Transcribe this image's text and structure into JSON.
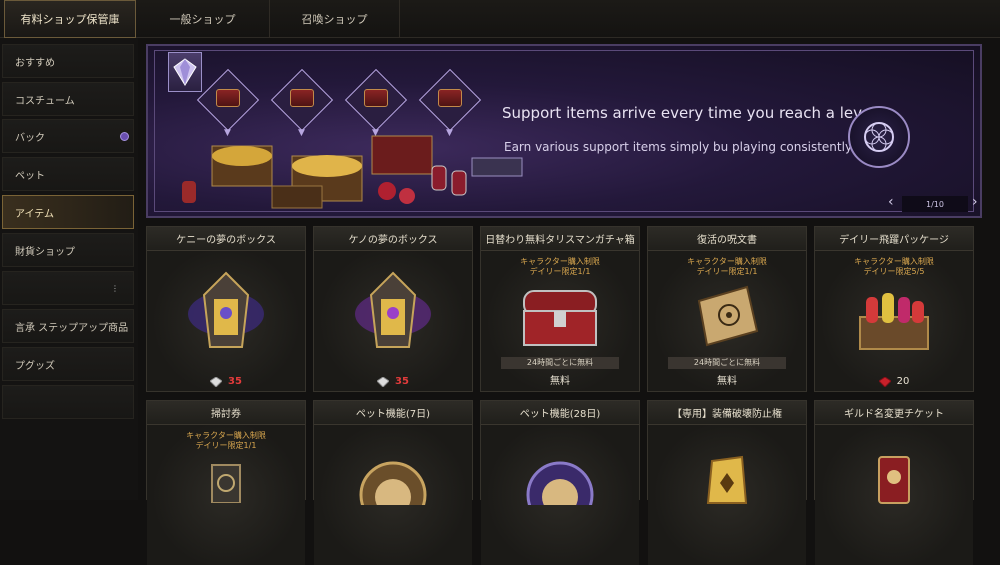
{
  "top_tabs": [
    {
      "label": "有料ショップ保管庫",
      "active": true
    },
    {
      "label": "一般ショップ",
      "active": false
    },
    {
      "label": "召喚ショップ",
      "active": false
    }
  ],
  "sidebar": {
    "items": [
      {
        "label": "おすすめ"
      },
      {
        "label": "コスチューム"
      },
      {
        "label": "バック"
      },
      {
        "label": "ペット"
      },
      {
        "label": "アイテム"
      },
      {
        "label": "財貨ショップ"
      },
      {
        "label": ""
      },
      {
        "label": "言承 ステップアップ商品"
      },
      {
        "label": "プグッズ"
      },
      {
        "label": ""
      }
    ]
  },
  "banner": {
    "title": "Support items arrive every time you reach a level!",
    "subtitle": "Earn various support items simply bu playing consistently.",
    "page": "1/10",
    "accent": "#6b4fa8"
  },
  "products_row1": [
    {
      "title": "ケニーの夢のボックス",
      "limit_line1": "",
      "limit_line2": "",
      "strip": "",
      "price": "35",
      "currency": "crystal",
      "image": "purple-lantern-icon"
    },
    {
      "title": "ケノの夢のボックス",
      "limit_line1": "",
      "limit_line2": "",
      "strip": "",
      "price": "35",
      "currency": "crystal",
      "image": "purple-lantern-icon"
    },
    {
      "title": "日替わり無料タリスマンガチャ箱",
      "limit_line1": "キャラクター購入制限",
      "limit_line2": "デイリー限定1/1",
      "strip": "24時間ごとに無料",
      "price": "無料",
      "currency": "",
      "image": "red-chest-icon"
    },
    {
      "title": "復活の呪文書",
      "limit_line1": "キャラクター購入制限",
      "limit_line2": "デイリー限定1/1",
      "strip": "24時間ごとに無料",
      "price": "無料",
      "currency": "",
      "image": "scroll-icon"
    },
    {
      "title": "デイリー飛躍パッケージ",
      "limit_line1": "キャラクター購入制限",
      "limit_line2": "デイリー限定5/5",
      "strip": "",
      "price": "20",
      "currency": "ruby",
      "image": "potion-chest-icon"
    }
  ],
  "products_row2": [
    {
      "title": "掃討券",
      "limit_line1": "キャラクター購入制限",
      "limit_line2": "デイリー限定1/1",
      "image": "ticket-icon"
    },
    {
      "title": "ペット機能(7日)",
      "limit_line1": "",
      "limit_line2": "",
      "image": "pet-medal-icon"
    },
    {
      "title": "ペット機能(28日)",
      "limit_line1": "",
      "limit_line2": "",
      "image": "pet-medal-purple-icon"
    },
    {
      "title": "【専用】装備破壊防止権",
      "limit_line1": "",
      "limit_line2": "",
      "image": "gold-scroll-icon"
    },
    {
      "title": "ギルド名変更チケット",
      "limit_line1": "",
      "limit_line2": "",
      "image": "red-card-icon"
    }
  ]
}
